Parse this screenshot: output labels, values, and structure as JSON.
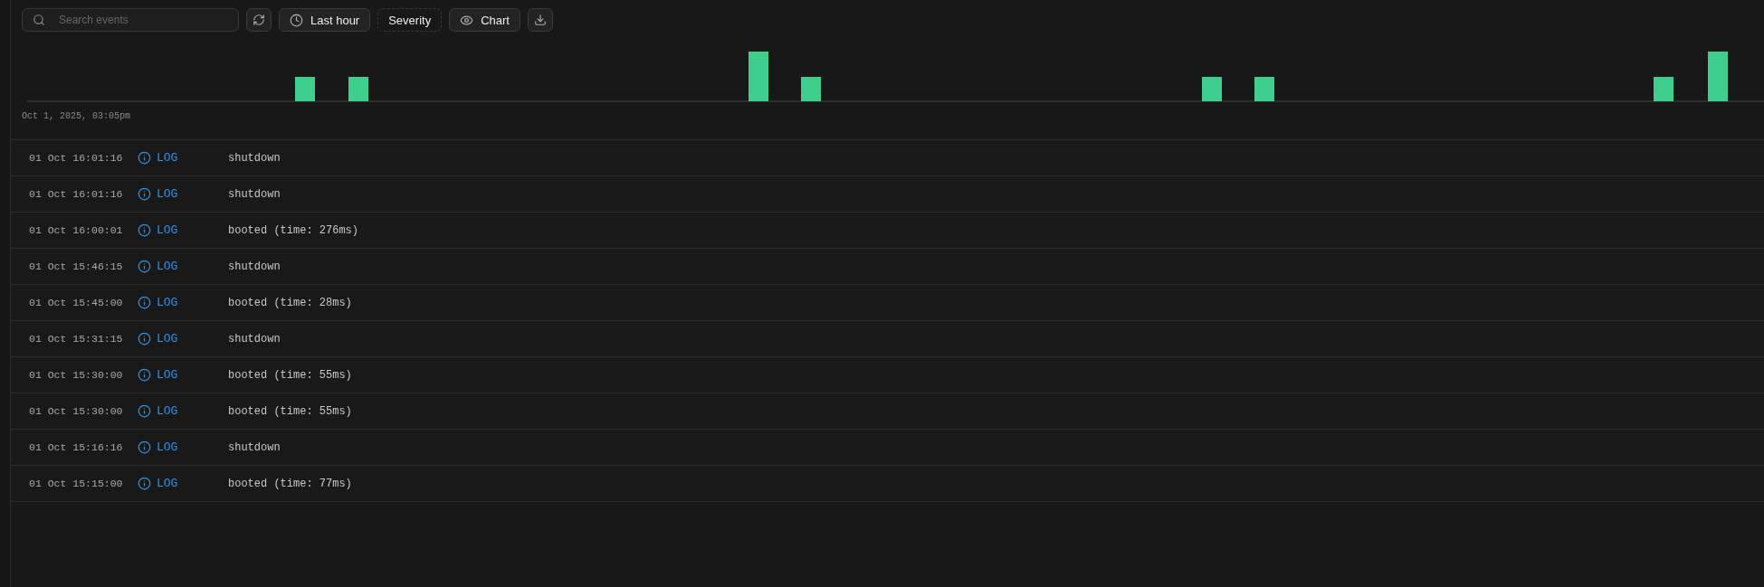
{
  "toolbar": {
    "search": {
      "placeholder": "Search events"
    },
    "time_range": {
      "label": "Last hour"
    },
    "severity": {
      "label": "Severity"
    },
    "chart_toggle": {
      "label": "Chart"
    }
  },
  "histogram": {
    "kind": "picture",
    "start_label": "Oct 1, 2025, 03:05pm"
  },
  "events": [
    {
      "time": "01 Oct 16:01:16",
      "level": "LOG",
      "message": "shutdown"
    },
    {
      "time": "01 Oct 16:01:16",
      "level": "LOG",
      "message": "shutdown"
    },
    {
      "time": "01 Oct 16:00:01",
      "level": "LOG",
      "message": "booted (time: 276ms)"
    },
    {
      "time": "01 Oct 15:46:15",
      "level": "LOG",
      "message": "shutdown"
    },
    {
      "time": "01 Oct 15:45:00",
      "level": "LOG",
      "message": "booted (time: 28ms)"
    },
    {
      "time": "01 Oct 15:31:15",
      "level": "LOG",
      "message": "shutdown"
    },
    {
      "time": "01 Oct 15:30:00",
      "level": "LOG",
      "message": "booted (time: 55ms)"
    },
    {
      "time": "01 Oct 15:30:00",
      "level": "LOG",
      "message": "booted (time: 55ms)"
    },
    {
      "time": "01 Oct 15:16:16",
      "level": "LOG",
      "message": "shutdown"
    },
    {
      "time": "01 Oct 15:15:00",
      "level": "LOG",
      "message": "booted (time: 77ms)"
    }
  ]
}
